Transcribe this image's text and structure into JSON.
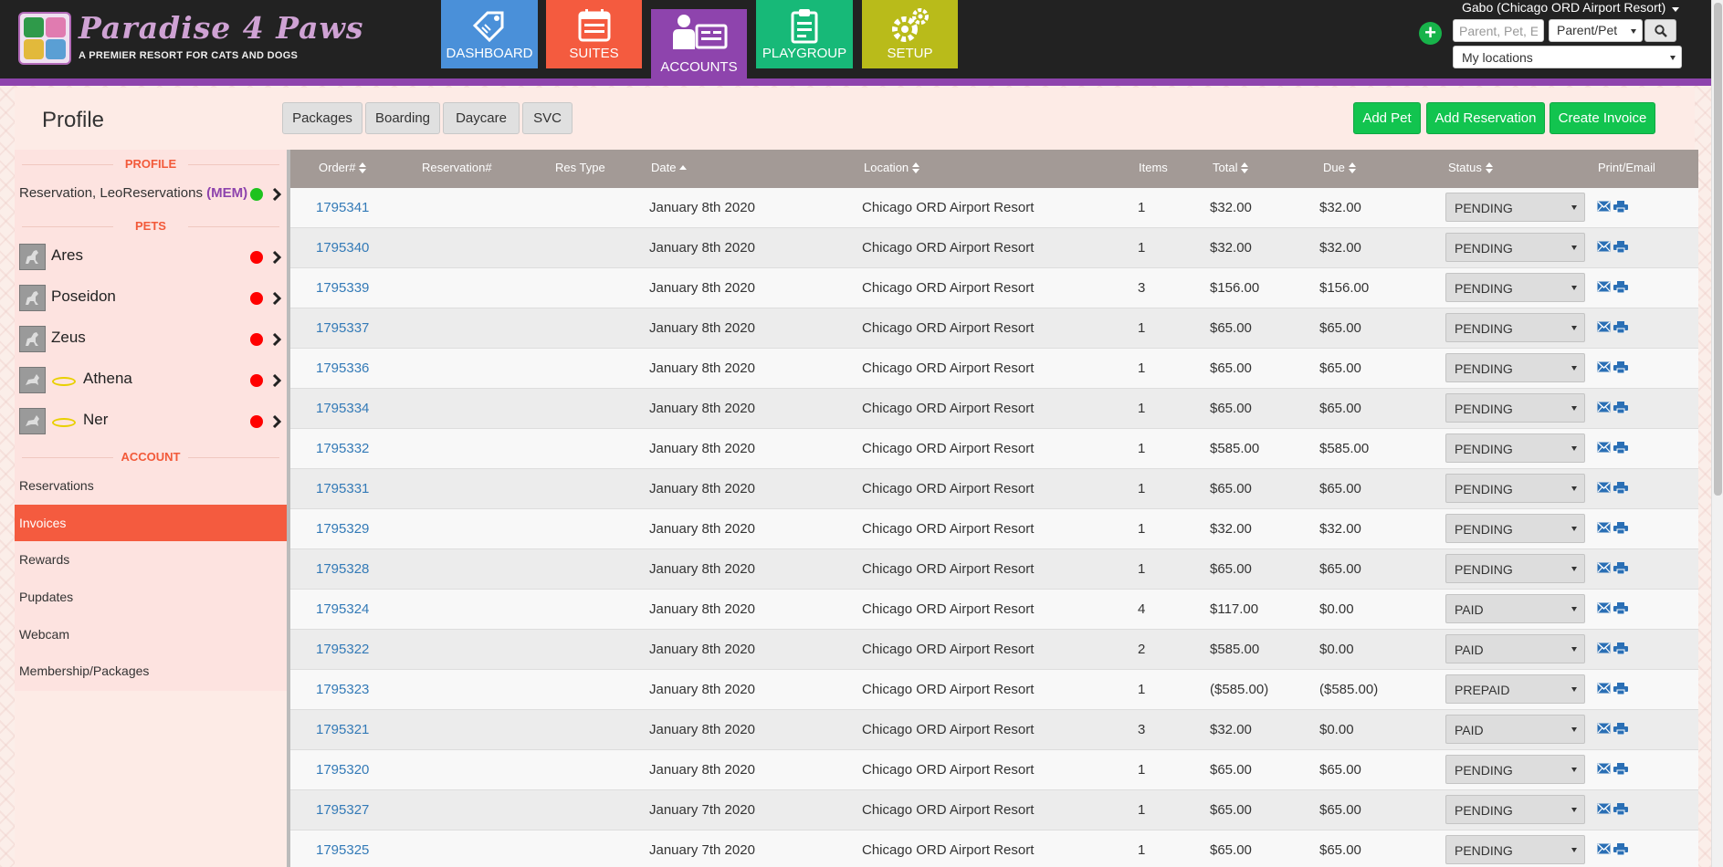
{
  "header": {
    "logo_title": "Paradise 4 Paws",
    "logo_subtitle": "A PREMIER RESORT FOR CATS AND DOGS",
    "nav": [
      {
        "label": "DASHBOARD",
        "color": "#4a90d9",
        "icon": "tag-icon"
      },
      {
        "label": "SUITES",
        "color": "#f45b3f",
        "icon": "calendar-icon"
      },
      {
        "label": "ACCOUNTS",
        "color": "#8e44ad",
        "icon": "user-card-icon",
        "active": true
      },
      {
        "label": "PLAYGROUP",
        "color": "#17b978",
        "icon": "clipboard-icon"
      },
      {
        "label": "SETUP",
        "color": "#b9bb1a",
        "icon": "gears-icon"
      }
    ],
    "user": "Gabo (Chicago ORD Airport Resort)",
    "search": {
      "placeholder": "Parent, Pet, E",
      "type": "Parent/Pet"
    },
    "location_select": "My locations"
  },
  "page": {
    "title": "Profile",
    "tabs": [
      "Packages",
      "Boarding",
      "Daycare",
      "SVC"
    ],
    "actions": [
      "Add Pet",
      "Add Reservation",
      "Create Invoice"
    ]
  },
  "sidebar": {
    "profile_heading": "PROFILE",
    "profile_name": "Reservation, LeoReservations",
    "profile_tag": "(MEM)",
    "pets_heading": "PETS",
    "pets": [
      {
        "name": "Ares",
        "halo": false
      },
      {
        "name": "Poseidon",
        "halo": false
      },
      {
        "name": "Zeus",
        "halo": false
      },
      {
        "name": "Athena",
        "halo": true
      },
      {
        "name": "Ner",
        "halo": true
      }
    ],
    "account_heading": "ACCOUNT",
    "account_links": [
      "Reservations",
      "Invoices",
      "Rewards",
      "Pupdates",
      "Webcam",
      "Membership/Packages"
    ],
    "active_link": "Invoices"
  },
  "table": {
    "columns": [
      "Order#",
      "Reservation#",
      "Res Type",
      "Date",
      "Location",
      "Items",
      "Total",
      "Due",
      "Status",
      "Print/Email"
    ],
    "rows": [
      {
        "order": "1795341",
        "date": "January 8th 2020",
        "location": "Chicago ORD Airport Resort",
        "items": "1",
        "total": "$32.00",
        "due": "$32.00",
        "status": "PENDING"
      },
      {
        "order": "1795340",
        "date": "January 8th 2020",
        "location": "Chicago ORD Airport Resort",
        "items": "1",
        "total": "$32.00",
        "due": "$32.00",
        "status": "PENDING"
      },
      {
        "order": "1795339",
        "date": "January 8th 2020",
        "location": "Chicago ORD Airport Resort",
        "items": "3",
        "total": "$156.00",
        "due": "$156.00",
        "status": "PENDING"
      },
      {
        "order": "1795337",
        "date": "January 8th 2020",
        "location": "Chicago ORD Airport Resort",
        "items": "1",
        "total": "$65.00",
        "due": "$65.00",
        "status": "PENDING"
      },
      {
        "order": "1795336",
        "date": "January 8th 2020",
        "location": "Chicago ORD Airport Resort",
        "items": "1",
        "total": "$65.00",
        "due": "$65.00",
        "status": "PENDING"
      },
      {
        "order": "1795334",
        "date": "January 8th 2020",
        "location": "Chicago ORD Airport Resort",
        "items": "1",
        "total": "$65.00",
        "due": "$65.00",
        "status": "PENDING"
      },
      {
        "order": "1795332",
        "date": "January 8th 2020",
        "location": "Chicago ORD Airport Resort",
        "items": "1",
        "total": "$585.00",
        "due": "$585.00",
        "status": "PENDING"
      },
      {
        "order": "1795331",
        "date": "January 8th 2020",
        "location": "Chicago ORD Airport Resort",
        "items": "1",
        "total": "$65.00",
        "due": "$65.00",
        "status": "PENDING"
      },
      {
        "order": "1795329",
        "date": "January 8th 2020",
        "location": "Chicago ORD Airport Resort",
        "items": "1",
        "total": "$32.00",
        "due": "$32.00",
        "status": "PENDING"
      },
      {
        "order": "1795328",
        "date": "January 8th 2020",
        "location": "Chicago ORD Airport Resort",
        "items": "1",
        "total": "$65.00",
        "due": "$65.00",
        "status": "PENDING"
      },
      {
        "order": "1795324",
        "date": "January 8th 2020",
        "location": "Chicago ORD Airport Resort",
        "items": "4",
        "total": "$117.00",
        "due": "$0.00",
        "status": "PAID"
      },
      {
        "order": "1795322",
        "date": "January 8th 2020",
        "location": "Chicago ORD Airport Resort",
        "items": "2",
        "total": "$585.00",
        "due": "$0.00",
        "status": "PAID"
      },
      {
        "order": "1795323",
        "date": "January 8th 2020",
        "location": "Chicago ORD Airport Resort",
        "items": "1",
        "total": "($585.00)",
        "due": "($585.00)",
        "status": "PREPAID"
      },
      {
        "order": "1795321",
        "date": "January 8th 2020",
        "location": "Chicago ORD Airport Resort",
        "items": "3",
        "total": "$32.00",
        "due": "$0.00",
        "status": "PAID"
      },
      {
        "order": "1795320",
        "date": "January 8th 2020",
        "location": "Chicago ORD Airport Resort",
        "items": "1",
        "total": "$65.00",
        "due": "$65.00",
        "status": "PENDING"
      },
      {
        "order": "1795327",
        "date": "January 7th 2020",
        "location": "Chicago ORD Airport Resort",
        "items": "1",
        "total": "$65.00",
        "due": "$65.00",
        "status": "PENDING"
      },
      {
        "order": "1795325",
        "date": "January 7th 2020",
        "location": "Chicago ORD Airport Resort",
        "items": "1",
        "total": "$65.00",
        "due": "$65.00",
        "status": "PENDING"
      }
    ]
  },
  "colors": {
    "accent": "#8e44ad",
    "link": "#337ab7",
    "green": "#12c44f",
    "orange": "#f45b3f"
  }
}
